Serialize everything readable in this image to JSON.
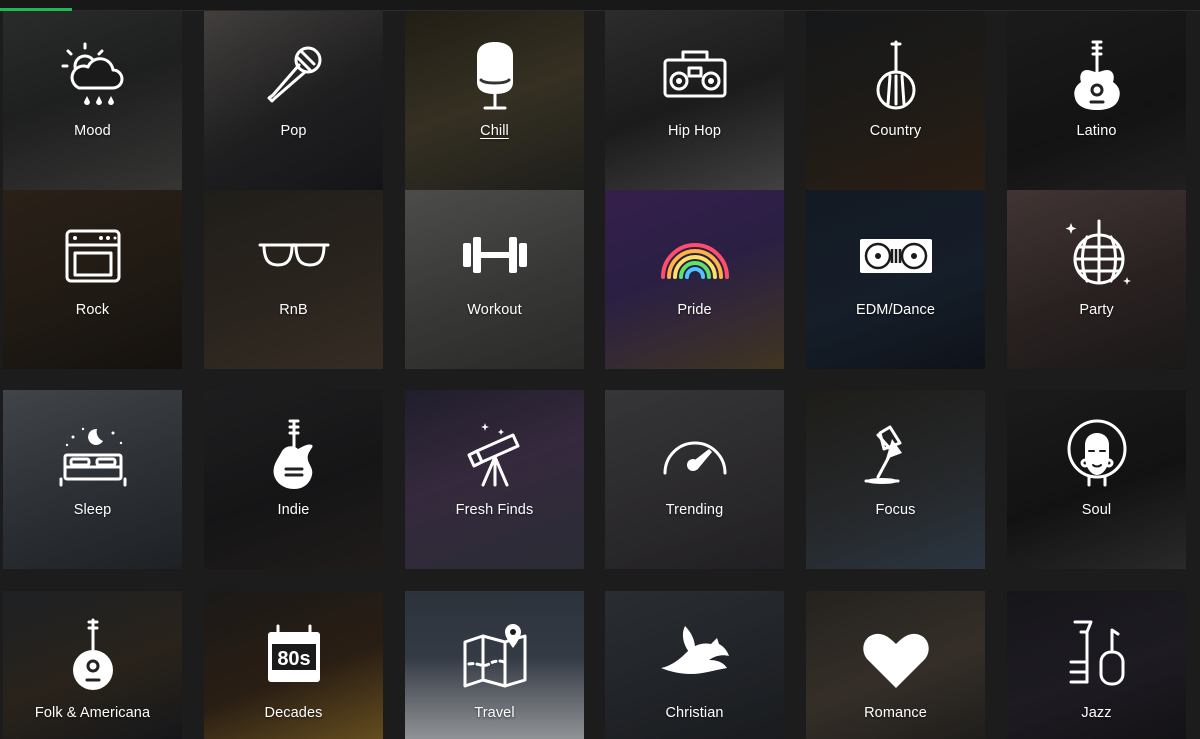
{
  "progress": {
    "value_percent": 6
  },
  "genres": [
    {
      "label": "Mood",
      "icon": "weather-icon",
      "active": false
    },
    {
      "label": "Pop",
      "icon": "microphone-icon",
      "active": false
    },
    {
      "label": "Chill",
      "icon": "egg-chair-icon",
      "active": true
    },
    {
      "label": "Hip Hop",
      "icon": "boombox-icon",
      "active": false
    },
    {
      "label": "Country",
      "icon": "banjo-icon",
      "active": false
    },
    {
      "label": "Latino",
      "icon": "guitar-icon",
      "active": false
    },
    {
      "label": "Rock",
      "icon": "amplifier-icon",
      "active": false
    },
    {
      "label": "RnB",
      "icon": "sunglasses-icon",
      "active": false
    },
    {
      "label": "Workout",
      "icon": "dumbbell-icon",
      "active": false
    },
    {
      "label": "Pride",
      "icon": "rainbow-icon",
      "active": false
    },
    {
      "label": "EDM/Dance",
      "icon": "turntables-icon",
      "active": false
    },
    {
      "label": "Party",
      "icon": "disco-ball-icon",
      "active": false
    },
    {
      "label": "Sleep",
      "icon": "bed-icon",
      "active": false
    },
    {
      "label": "Indie",
      "icon": "electric-guitar-icon",
      "active": false
    },
    {
      "label": "Fresh Finds",
      "icon": "telescope-icon",
      "active": false
    },
    {
      "label": "Trending",
      "icon": "gauge-icon",
      "active": false
    },
    {
      "label": "Focus",
      "icon": "desk-lamp-icon",
      "active": false
    },
    {
      "label": "Soul",
      "icon": "afro-face-icon",
      "active": false
    },
    {
      "label": "Folk & Americana",
      "icon": "mandolin-icon",
      "active": false
    },
    {
      "label": "Decades",
      "icon": "calendar-80s-icon",
      "active": false
    },
    {
      "label": "Travel",
      "icon": "map-pin-icon",
      "active": false
    },
    {
      "label": "Christian",
      "icon": "dove-icon",
      "active": false
    },
    {
      "label": "Romance",
      "icon": "heart-icon",
      "active": false
    },
    {
      "label": "Jazz",
      "icon": "brass-instruments-icon",
      "active": false
    }
  ],
  "calendar_text": "80s"
}
